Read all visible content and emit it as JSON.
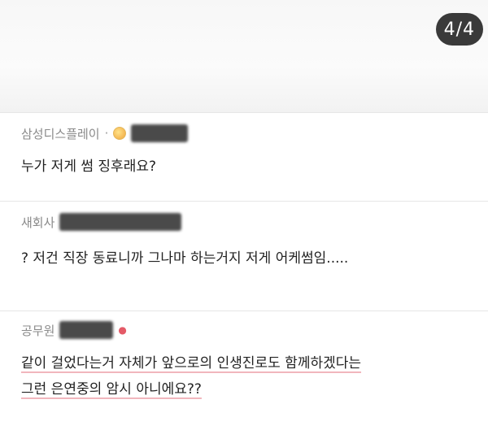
{
  "counter": "4/4",
  "comments": [
    {
      "author": "삼성디스플레이",
      "separator": "·",
      "text_lines": [
        "누가 저게 썸 징후래요?"
      ]
    },
    {
      "author": "새회사",
      "text_lines": [
        "? 저건 직장 동료니까 그나마 하는거지 저게 어케썸임....."
      ]
    },
    {
      "author": "공무원",
      "text_lines": [
        "같이 걸었다는거 자체가 앞으로의 인생진로도 함께하겠다는",
        "그런 은연중의 암시 아니에요??"
      ]
    }
  ],
  "colors": {
    "counter_bg": "#3a3a3a",
    "meta_text": "#8a8a8a",
    "highlight_underline": "#f1b6bd",
    "red_dot": "#e45a67"
  },
  "icons": {
    "badge": "badge-icon",
    "new_indicator": "red-dot-icon"
  }
}
